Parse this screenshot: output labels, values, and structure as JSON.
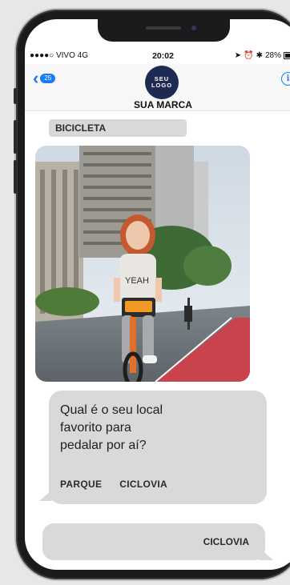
{
  "status_bar": {
    "carrier": "●●●●○ VIVO",
    "network": "4G",
    "time": "20:02",
    "battery": "28%"
  },
  "header": {
    "back_count": "25",
    "logo_line1": "SEU",
    "logo_line2": "LOGO",
    "brand_name": "SUA MARCA",
    "info_symbol": "i"
  },
  "chat": {
    "topic": "BICICLETA",
    "question_line1": "Qual é o seu local",
    "question_line2": "favorito para",
    "question_line3": "pedalar por aí?",
    "option1": "PARQUE",
    "option2": "CICLOVIA",
    "photo_shirt_text": "YEAH",
    "reply": "CICLOVIA"
  },
  "colors": {
    "accent": "#1a7cf5",
    "bubble": "#d9d9d9",
    "logo_bg": "#1e2a52"
  }
}
